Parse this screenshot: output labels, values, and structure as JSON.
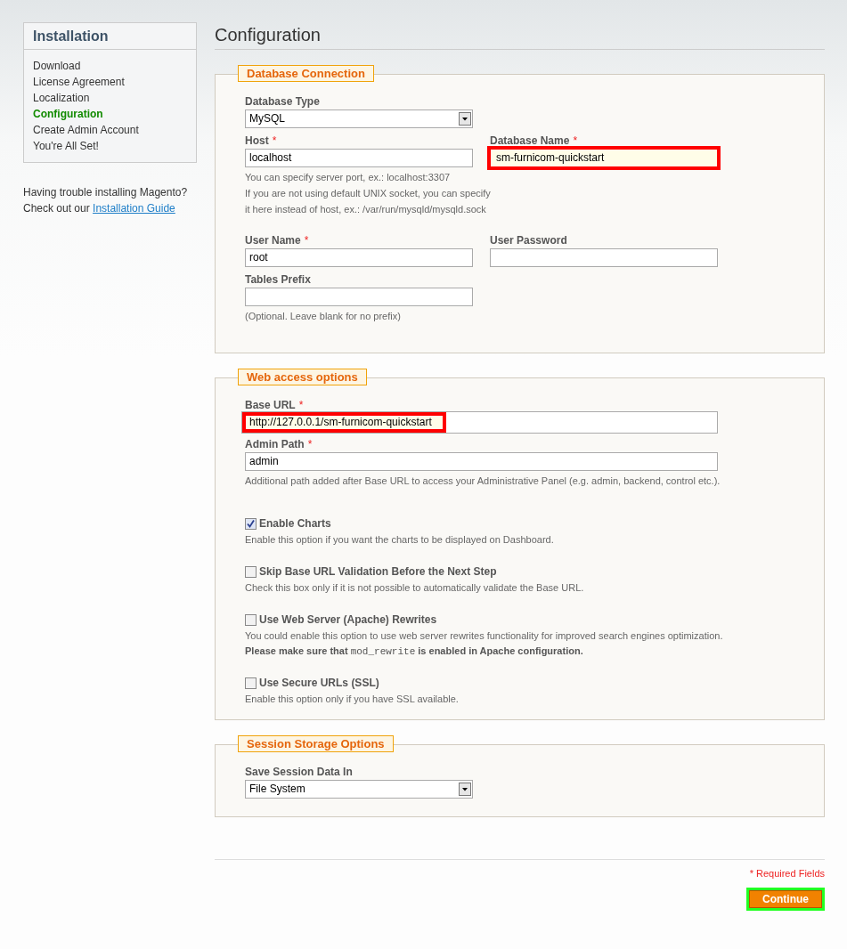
{
  "sidebar": {
    "title": "Installation",
    "steps": [
      {
        "label": "Download",
        "selected": false
      },
      {
        "label": "License Agreement",
        "selected": false
      },
      {
        "label": "Localization",
        "selected": false
      },
      {
        "label": "Configuration",
        "selected": true
      },
      {
        "label": "Create Admin Account",
        "selected": false
      },
      {
        "label": "You're All Set!",
        "selected": false
      }
    ],
    "help_text": "Having trouble installing Magento? Check out our",
    "help_link": "Installation Guide"
  },
  "page_title": "Configuration",
  "sections": [
    {
      "legend": "Database Connection",
      "rows": [
        {
          "kind": "fields",
          "cells": [
            {
              "label": "Database Type",
              "control": {
                "kind": "select",
                "value": "MySQL"
              }
            }
          ]
        },
        {
          "kind": "fields",
          "cells": [
            {
              "label": "Host",
              "required_mark": "*",
              "control": {
                "kind": "text",
                "value": "localhost",
                "highlighted": false
              },
              "notes": [
                "You can specify server port, ex.: localhost:3307",
                "If you are not using default UNIX socket, you can specify",
                "it here instead of host, ex.: /var/run/mysqld/mysqld.sock"
              ]
            },
            {
              "label": "Database Name",
              "required_mark": "*",
              "control": {
                "kind": "text",
                "value": "sm-furnicom-quickstart",
                "highlighted": true
              }
            }
          ]
        },
        {
          "kind": "fields",
          "cells": [
            {
              "label": "User Name",
              "required_mark": "*",
              "control": {
                "kind": "text",
                "value": "root",
                "highlighted": false
              }
            },
            {
              "label": "User Password",
              "control": {
                "kind": "text",
                "highlighted": false
              }
            }
          ]
        },
        {
          "kind": "fields",
          "cells": [
            {
              "label": "Tables Prefix",
              "control": {
                "kind": "text",
                "highlighted": false
              },
              "notes": [
                "(Optional. Leave blank for no prefix)"
              ]
            }
          ]
        }
      ]
    },
    {
      "legend": "Web access options",
      "rows": [
        {
          "kind": "wide",
          "cells": [
            {
              "label": "Base URL",
              "required_mark": "*",
              "control": {
                "kind": "text",
                "value": "http://127.0.0.1/sm-furnicom-quickstart",
                "highlighted": true
              }
            }
          ]
        },
        {
          "kind": "wide",
          "cells": [
            {
              "label": "Admin Path",
              "required_mark": "*",
              "control": {
                "kind": "text",
                "value": "admin",
                "highlighted": false
              },
              "notes": [
                "Additional path added after Base URL to access your Administrative Panel (e.g. admin, backend, control etc.)."
              ]
            }
          ]
        },
        {
          "kind": "checkbox",
          "label": "Enable Charts",
          "checked": true,
          "notes": [
            "Enable this option if you want the charts to be displayed on Dashboard."
          ]
        },
        {
          "kind": "checkbox",
          "label": "Skip Base URL Validation Before the Next Step",
          "checked": false,
          "notes": [
            "Check this box only if it is not possible to automatically validate the Base URL."
          ]
        },
        {
          "kind": "checkbox",
          "label": "Use Web Server (Apache) Rewrites",
          "checked": false,
          "notes": [
            "You could enable this option to use web server rewrites functionality for improved search engines optimization."
          ],
          "warning": [
            {
              "kind": "text",
              "text": "Please make sure that "
            },
            {
              "kind": "code",
              "text": "mod_rewrite"
            },
            {
              "kind": "text",
              "text": " is enabled in Apache configuration."
            }
          ]
        },
        {
          "kind": "checkbox",
          "label": "Use Secure URLs (SSL)",
          "checked": false,
          "notes": [
            "Enable this option only if you have SSL available."
          ]
        }
      ]
    },
    {
      "legend": "Session Storage Options",
      "rows": [
        {
          "kind": "fields",
          "cells": [
            {
              "label": "Save Session Data In",
              "control": {
                "kind": "select",
                "value": "File System"
              }
            }
          ]
        }
      ]
    }
  ],
  "required_note": "* Required Fields",
  "continue_button": {
    "label": "Continue",
    "highlighted": true
  }
}
